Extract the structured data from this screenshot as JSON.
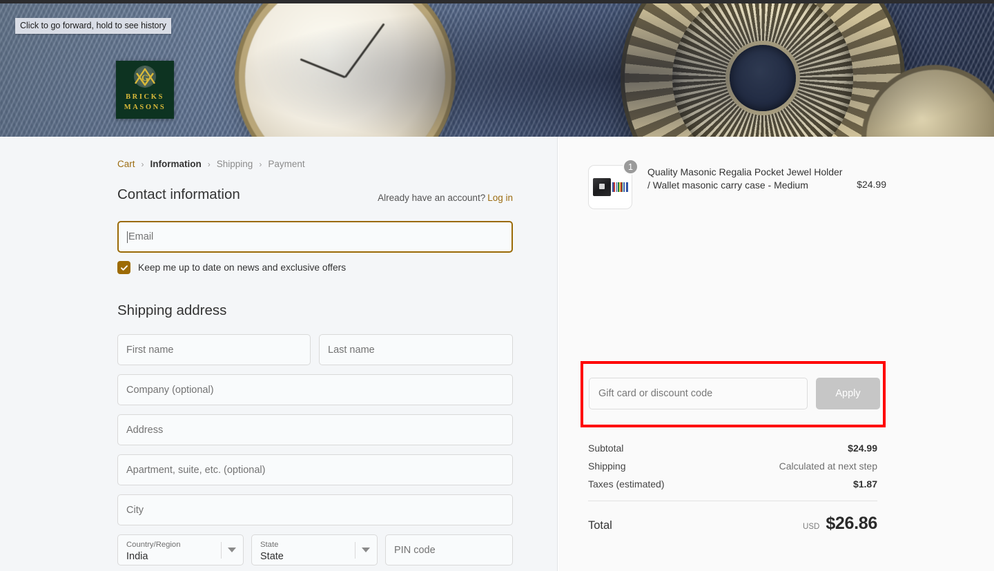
{
  "browser": {
    "tooltip": "Click to go forward, hold to see history"
  },
  "brand": {
    "logo_line1": "BRICKS",
    "logo_line2": "MASONS",
    "logo_icon": "masonic-square-compass-icon",
    "logo_bg": "#0d3321",
    "logo_text_color": "#d9b93a",
    "accent_color": "#9c6d12"
  },
  "breadcrumb": {
    "items": [
      {
        "label": "Cart",
        "state": "link"
      },
      {
        "label": "Information",
        "state": "current"
      },
      {
        "label": "Shipping",
        "state": "upcoming"
      },
      {
        "label": "Payment",
        "state": "upcoming"
      }
    ],
    "separator": "›"
  },
  "contact": {
    "title": "Contact information",
    "account_prompt": "Already have an account?",
    "login_label": "Log in",
    "email_placeholder": "Email",
    "email_value": "",
    "newsletter_label": "Keep me up to date on news and exclusive offers",
    "newsletter_checked": true
  },
  "shipping": {
    "title": "Shipping address",
    "fields": [
      {
        "name": "first-name",
        "placeholder": "First name",
        "value": ""
      },
      {
        "name": "last-name",
        "placeholder": "Last name",
        "value": ""
      },
      {
        "name": "company",
        "placeholder": "Company (optional)",
        "value": ""
      },
      {
        "name": "address",
        "placeholder": "Address",
        "value": ""
      },
      {
        "name": "apartment",
        "placeholder": "Apartment, suite, etc. (optional)",
        "value": ""
      },
      {
        "name": "city",
        "placeholder": "City",
        "value": ""
      }
    ],
    "country": {
      "label": "Country/Region",
      "value": "India"
    },
    "state": {
      "label": "State",
      "value": "State"
    },
    "postal": {
      "placeholder": "PIN code",
      "value": ""
    }
  },
  "order_summary": {
    "product": {
      "title": "Quality Masonic Regalia Pocket Jewel Holder / Wallet masonic carry case - Medium",
      "price": "$24.99",
      "quantity": "1"
    },
    "discount": {
      "placeholder": "Gift card or discount code",
      "value": "",
      "apply_label": "Apply",
      "apply_disabled": true,
      "highlight_color": "#ff0000"
    },
    "lines": [
      {
        "label": "Subtotal",
        "value": "$24.99",
        "muted": false
      },
      {
        "label": "Shipping",
        "value": "Calculated at next step",
        "muted": true
      },
      {
        "label": "Taxes (estimated)",
        "value": "$1.87",
        "muted": false
      }
    ],
    "total": {
      "label": "Total",
      "currency": "USD",
      "amount": "$26.86"
    }
  }
}
